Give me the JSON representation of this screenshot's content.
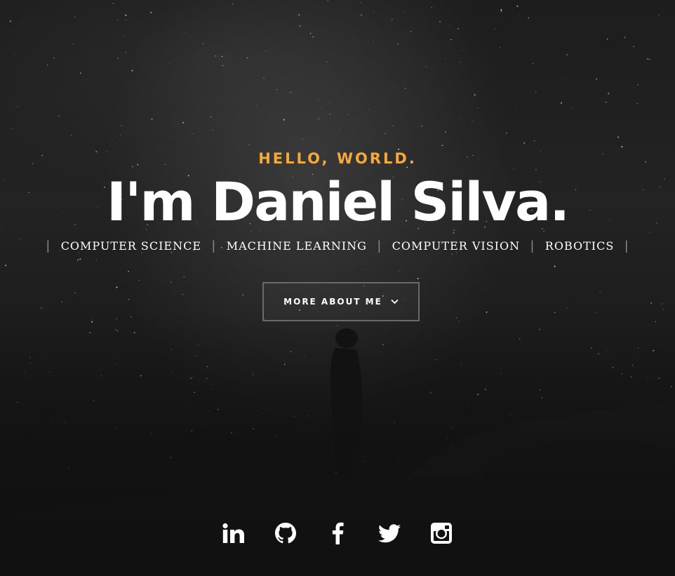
{
  "hero": {
    "greeting": "HELLO, WORLD.",
    "name": "I'm Daniel Silva.",
    "tags": [
      "COMPUTER SCIENCE",
      "MACHINE LEARNING",
      "COMPUTER VISION",
      "ROBOTICS"
    ],
    "separator": "|",
    "button_label": "MORE ABOUT ME",
    "button_icon": "chevron-down-icon"
  },
  "social": {
    "icons": [
      "linkedin-icon",
      "github-icon",
      "facebook-icon",
      "twitter-icon",
      "instagram-icon"
    ]
  },
  "colors": {
    "accent": "#f6a93b",
    "text": "#ffffff",
    "background": "#1a1a1a",
    "button_border": "#6a6a6a"
  }
}
